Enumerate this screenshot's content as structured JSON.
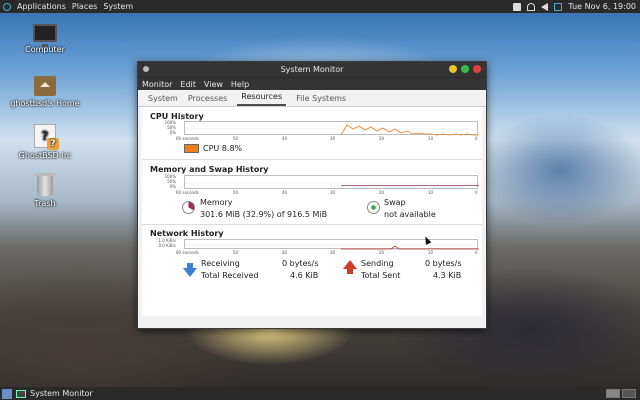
{
  "top_panel": {
    "menus": [
      "Applications",
      "Places",
      "System"
    ],
    "clock": "Tue Nov  6, 19:00"
  },
  "desktop_icons": [
    {
      "label": "Computer",
      "icon": "computer-icon"
    },
    {
      "label": "ghostbsd's Home",
      "icon": "home-folder-icon"
    },
    {
      "label": "GhostBSD-irc",
      "icon": "irc-icon"
    },
    {
      "label": "Trash",
      "icon": "trash-icon"
    }
  ],
  "window": {
    "title": "System Monitor",
    "menus": [
      "Monitor",
      "Edit",
      "View",
      "Help"
    ],
    "tabs": [
      "System",
      "Processes",
      "Resources",
      "File Systems"
    ],
    "active_tab": "Resources",
    "controls_colors": [
      "#e8c12c",
      "#3cb84a",
      "#e04040"
    ]
  },
  "cpu": {
    "title": "CPU History",
    "y_ticks": [
      "100%",
      "50%",
      "0%"
    ],
    "x_ticks": [
      "60 seconds",
      "50",
      "40",
      "30",
      "20",
      "10",
      "0"
    ],
    "legend": "CPU  8.8%",
    "color": "#f07d1e"
  },
  "memory": {
    "title": "Memory and Swap History",
    "y_ticks": [
      "100%",
      "50%",
      "0%"
    ],
    "x_ticks": [
      "60 seconds",
      "50",
      "40",
      "30",
      "20",
      "10",
      "0"
    ],
    "mem_label": "Memory",
    "mem_value": "301.6 MiB (32.9%) of 916.5 MiB",
    "swap_label": "Swap",
    "swap_value": "not available",
    "mem_color": "#9c2d5c",
    "swap_color": "#3aa045"
  },
  "network": {
    "title": "Network History",
    "y_ticks": [
      "1.0 KiB/s",
      "0.0 KiB/s"
    ],
    "x_ticks": [
      "60 seconds",
      "50",
      "40",
      "30",
      "20",
      "10",
      "0"
    ],
    "receiving_label": "Receiving",
    "receiving_value": "0 bytes/s",
    "total_received_label": "Total Received",
    "total_received_value": "4.6 KiB",
    "sending_label": "Sending",
    "sending_value": "0 bytes/s",
    "total_sent_label": "Total Sent",
    "total_sent_value": "4.3 KiB"
  },
  "bottom_panel": {
    "task": "System Monitor"
  }
}
